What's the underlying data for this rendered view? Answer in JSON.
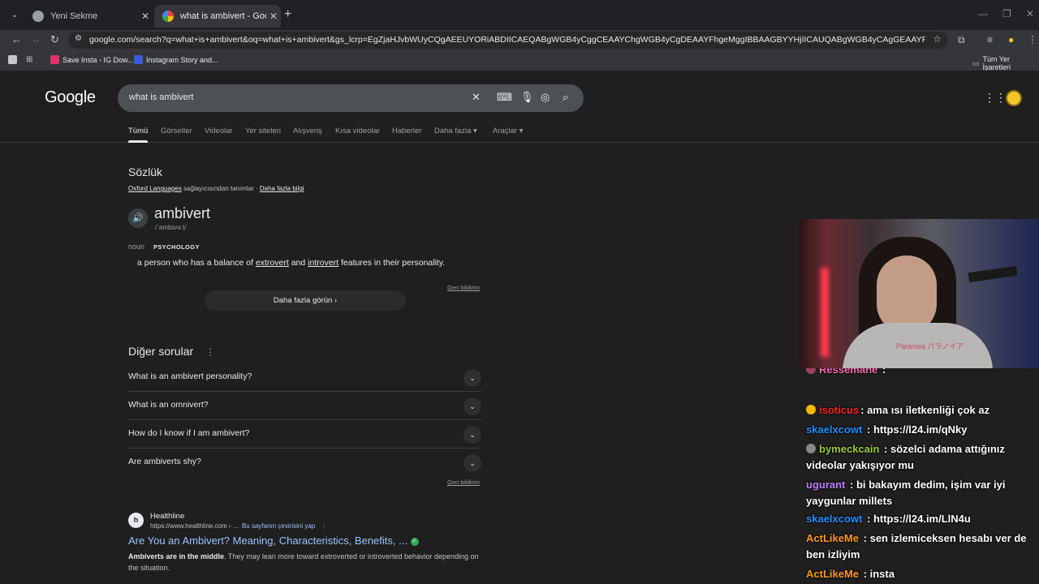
{
  "browser": {
    "tabs": [
      {
        "title": "Yeni Sekme",
        "active": false
      },
      {
        "title": "what is ambivert - Google'da Ara",
        "active": true
      }
    ],
    "url": "google.com/search?q=what+is+ambivert&oq=what+is+ambivert&gs_lcrp=EgZjaHJvbWUyCQgAEEUYORiABDIICAEQABgWGB4yCggCEAAYChgWGB4yCgDEAAYFhgeMggIBBAAGBYYHjIICAUQABgWGB4yCAgGEAAYFhgeMggIBxAAGBYYHjIICAgQABgWGB...",
    "bookmarks": [
      {
        "label": "Save Insta - IG Dow...",
        "color": "#e1306c"
      },
      {
        "label": "Instagram Story and...",
        "color": "#3b5bdb"
      }
    ],
    "all_bookmarks": "Tüm Yer İşaretleri"
  },
  "google": {
    "logo": "Google",
    "query": "what is ambivert",
    "nav_tabs": [
      "Tümü",
      "Görseller",
      "Videolar",
      "Yer siteleri",
      "Alışveriş",
      "Kısa videolar",
      "Haberler",
      "Daha fazla ▾",
      "Araçlar ▾"
    ]
  },
  "dictionary": {
    "heading": "Sözlük",
    "source_link": "Oxford Languages",
    "source_text": " sağlayıcısından tanımlar · ",
    "more_info": "Daha fazla bilgi",
    "word": "ambivert",
    "phonetic": "/ˈambɪvəːt/",
    "pos": "noun",
    "tag": "PSYCHOLOGY",
    "def_parts": [
      "a person who has a balance of ",
      "extrovert",
      " and ",
      "introvert",
      " features in their personality."
    ],
    "feedback": "Geri bildirim",
    "more_button": "Daha fazla görün"
  },
  "paa": {
    "heading": "Diğer sorular",
    "questions": [
      "What is an ambivert personality?",
      "What is an omnivert?",
      "How do I know if I am ambivert?",
      "Are ambiverts shy?"
    ],
    "feedback": "Geri bildirim"
  },
  "result": {
    "site": "Healthline",
    "url": "https://www.healthline.com › ...",
    "translate": "Bu sayfanın çevirisini yap",
    "title": "Are You an Ambivert? Meaning, Characteristics, Benefits, ...",
    "snippet_bold": "Ambiverts are in the middle",
    "snippet_rest": ". They may lean more toward extroverted or introverted behavior depending on the situation."
  },
  "stream": {
    "shirt_text": "Paranoia パラノイア",
    "chat": [
      {
        "user": "Ressemane",
        "text": "",
        "color": "#ff69b4",
        "badge": "#ff69b4"
      },
      {
        "user": "isoticus",
        "text": "ama ısı iletkenliği çok az",
        "color": "#ff2020",
        "badge": "#f5b700"
      },
      {
        "user": "skaelxcowt",
        "text": "https://l24.im/qNky",
        "color": "#1e90ff",
        "badge": ""
      },
      {
        "user": "bymeckcain",
        "text": "sözelci adama attığınız videolar yakışıyor mu",
        "color": "#9acd32",
        "badge": "#888888"
      },
      {
        "user": "ugurant",
        "text": "bi bakayım dedim, işim var iyi yaygunlar millets",
        "color": "#c080ff",
        "badge": ""
      },
      {
        "user": "skaelxcowt",
        "text": "https://l24.im/LlN4u",
        "color": "#1e90ff",
        "badge": ""
      },
      {
        "user": "ActLikeMe",
        "text": "sen izlemiceksen hesabı ver de ben izliyim",
        "color": "#ff9a1a",
        "badge": ""
      },
      {
        "user": "ActLikeMe",
        "text": "insta",
        "color": "#ff9a1a",
        "badge": ""
      }
    ]
  }
}
